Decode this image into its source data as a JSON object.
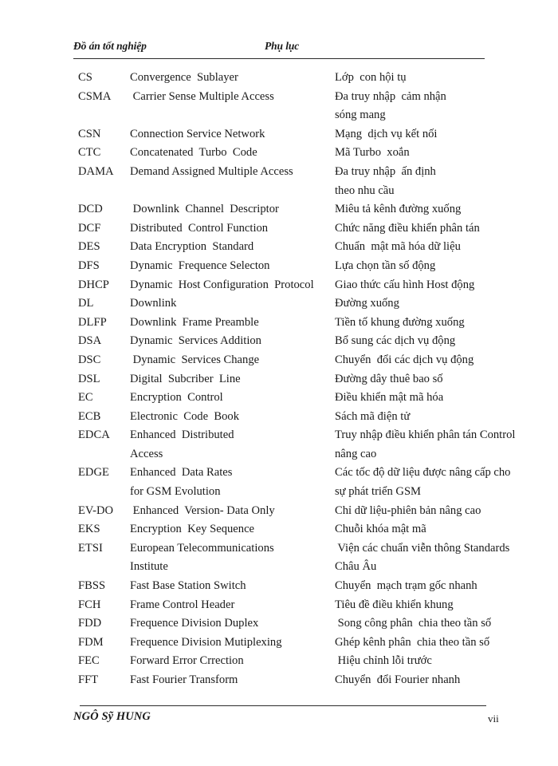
{
  "header": {
    "left": "Đồ án tốt nghiệp",
    "right": "Phụ lục"
  },
  "footer": {
    "author": "NGÔ Sỹ HUNG",
    "page_number": "vii"
  },
  "glossary": {
    "entries": [
      {
        "abbr": "CS",
        "english": "Convergence  Sublayer",
        "vietnamese": "Lớp  con hội tụ"
      },
      {
        "abbr": "CSMA",
        "english": " Carrier Sense Multiple Access",
        "vietnamese": "Đa truy nhập  cảm nhận"
      },
      {
        "abbr": "",
        "english": "",
        "vietnamese": "sóng mang"
      },
      {
        "abbr": "CSN",
        "english": "Connection Service Network",
        "vietnamese": "Mạng  dịch vụ kết nối"
      },
      {
        "abbr": "CTC",
        "english": "Concatenated  Turbo  Code",
        "vietnamese": "Mã Turbo  xoắn"
      },
      {
        "abbr": "DAMA",
        "english": "Demand Assigned Multiple Access",
        "vietnamese": "Đa truy nhập  ấn định"
      },
      {
        "abbr": "",
        "english": "",
        "vietnamese": "theo nhu cầu"
      },
      {
        "abbr": "DCD",
        "english": " Downlink  Channel  Descriptor",
        "vietnamese": "Miêu tả kênh đường xuống"
      },
      {
        "abbr": "DCF",
        "english": "Distributed  Control Function",
        "vietnamese": "Chức năng điều khiển phân tán"
      },
      {
        "abbr": "DES",
        "english": "Data Encryption  Standard",
        "vietnamese": "Chuẩn  mật mã hóa dữ liệu"
      },
      {
        "abbr": "DFS",
        "english": "Dynamic  Frequence Selecton",
        "vietnamese": "Lựa chọn tần số động"
      },
      {
        "abbr": "DHCP",
        "english": "Dynamic  Host Configuration  Protocol",
        "vietnamese": "Giao thức cấu hình Host động"
      },
      {
        "abbr": "DL",
        "english": "Downlink",
        "vietnamese": "Đường xuống"
      },
      {
        "abbr": "DLFP",
        "english": "Downlink  Frame Preamble",
        "vietnamese": "Tiền tố khung đường xuống"
      },
      {
        "abbr": "DSA",
        "english": "Dynamic  Services Addition",
        "vietnamese": "Bổ sung các dịch vụ động"
      },
      {
        "abbr": "DSC",
        "english": " Dynamic  Services Change",
        "vietnamese": "Chuyển  đổi các dịch vụ động"
      },
      {
        "abbr": "DSL",
        "english": "Digital  Subcriber  Line",
        "vietnamese": "Đường dây thuê bao số"
      },
      {
        "abbr": "EC",
        "english": "Encryption  Control",
        "vietnamese": "Điều khiển mật mã hóa"
      },
      {
        "abbr": "ECB",
        "english": "Electronic  Code  Book",
        "vietnamese": "Sách mã điện tử"
      },
      {
        "abbr": "EDCA",
        "english": "Enhanced  Distributed",
        "vietnamese": "Truy nhập điều khiển phân tán Control"
      },
      {
        "abbr": "",
        "english": "Access",
        "vietnamese": "nâng cao"
      },
      {
        "abbr": "EDGE",
        "english": "Enhanced  Data Rates",
        "vietnamese": "Các tốc độ dữ liệu được nâng cấp cho"
      },
      {
        "abbr": "",
        "english": "for GSM Evolution",
        "vietnamese": "sự phát triển GSM"
      },
      {
        "abbr": "EV-DO",
        "english": " Enhanced  Version- Data Only",
        "vietnamese": "Chỉ dữ liệu-phiên bản nâng cao"
      },
      {
        "abbr": "EKS",
        "english": "Encryption  Key Sequence",
        "vietnamese": "Chuỗi khóa mật mã"
      },
      {
        "abbr": "ETSI",
        "english": "European Telecommunications",
        "vietnamese": " Viện các chuẩn viễn thông Standards"
      },
      {
        "abbr": "",
        "english": "Institute",
        "vietnamese": "Châu Âu"
      },
      {
        "abbr": "FBSS",
        "english": "Fast Base Station Switch",
        "vietnamese": "Chuyển  mạch trạm gốc nhanh"
      },
      {
        "abbr": "FCH",
        "english": "Frame Control Header",
        "vietnamese": "Tiêu đề điều khiển khung"
      },
      {
        "abbr": "FDD",
        "english": "Frequence Division Duplex",
        "vietnamese": " Song công phân  chia theo tần số"
      },
      {
        "abbr": "FDM",
        "english": "Frequence Division Mutiplexing",
        "vietnamese": "Ghép kênh phân  chia theo tần số"
      },
      {
        "abbr": "FEC",
        "english": "Forward Error Crrection",
        "vietnamese": " Hiệu chỉnh lỗi trước"
      },
      {
        "abbr": "FFT",
        "english": "Fast Fourier Transform",
        "vietnamese": "Chuyển  đổi Fourier nhanh"
      }
    ]
  }
}
